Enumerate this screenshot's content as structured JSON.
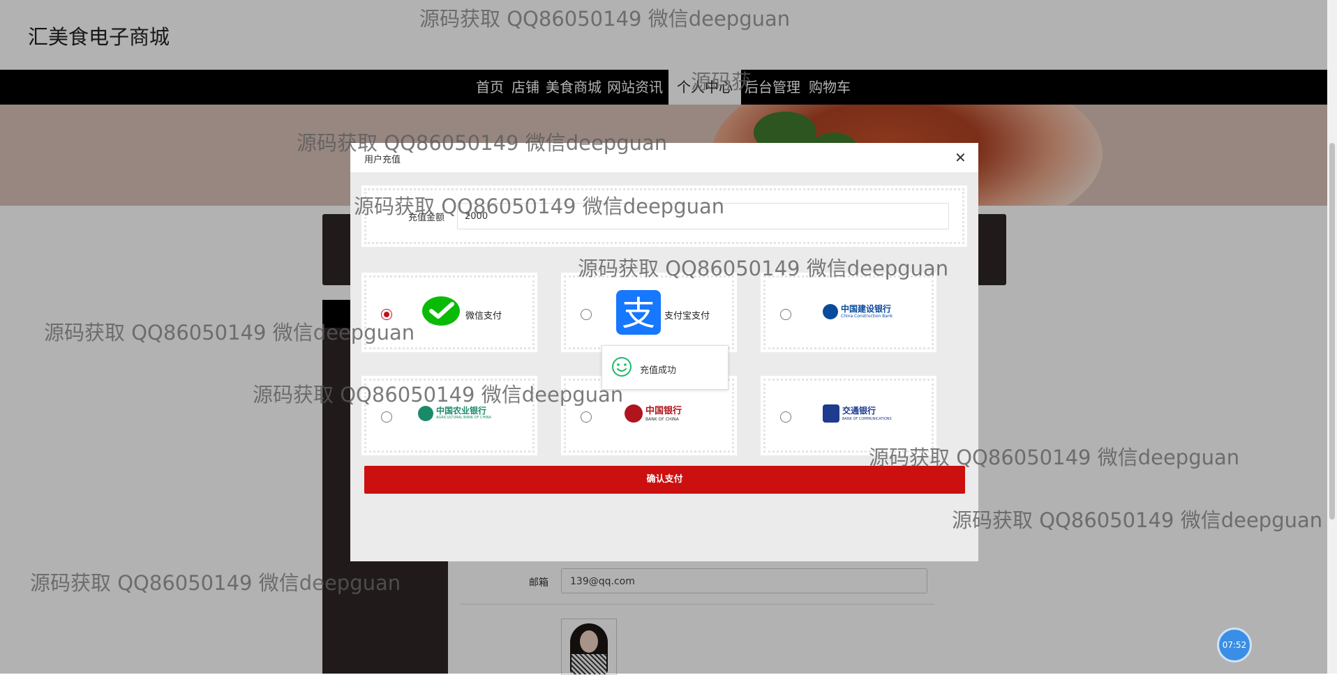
{
  "site": {
    "title": "汇美食电子商城"
  },
  "nav": {
    "items": [
      "首页",
      "店铺",
      "美食商城",
      "网站资讯",
      "个人中心",
      "后台管理",
      "购物车"
    ],
    "active": "个人中心"
  },
  "profile": {
    "email_label": "邮箱",
    "email_value": "139@qq.com"
  },
  "modal": {
    "title": "用户充值",
    "close_icon": "close-icon",
    "amount_label": "充值金额",
    "amount_value": "2000",
    "payment_methods": [
      {
        "name": "微信支付",
        "icon": "wechat-pay-icon",
        "selected": true
      },
      {
        "name": "支付宝支付",
        "icon": "alipay-icon",
        "selected": false
      },
      {
        "name": "中国建设银行",
        "sub": "China Construction Bank",
        "icon": "ccb-logo",
        "selected": false
      },
      {
        "name": "中国农业银行",
        "sub": "AGRICULTURAL BANK OF CHINA",
        "icon": "abc-logo",
        "selected": false
      },
      {
        "name": "中国银行",
        "sub": "BANK OF CHINA",
        "icon": "boc-logo",
        "selected": false
      },
      {
        "name": "交通银行",
        "sub": "BANK OF COMMUNICATIONS",
        "icon": "bocom-logo",
        "selected": false
      }
    ],
    "confirm_label": "确认支付"
  },
  "toast": {
    "text": "充值成功",
    "icon": "smile-icon"
  },
  "watermark": {
    "text": "源码获取 QQ86050149 微信deepguan",
    "partial": "源码获"
  },
  "clock": {
    "time": "07:52"
  },
  "colors": {
    "accent_red": "#cc0f0f",
    "nav_bg": "#000000",
    "sidebar_bg": "#2e2826"
  }
}
